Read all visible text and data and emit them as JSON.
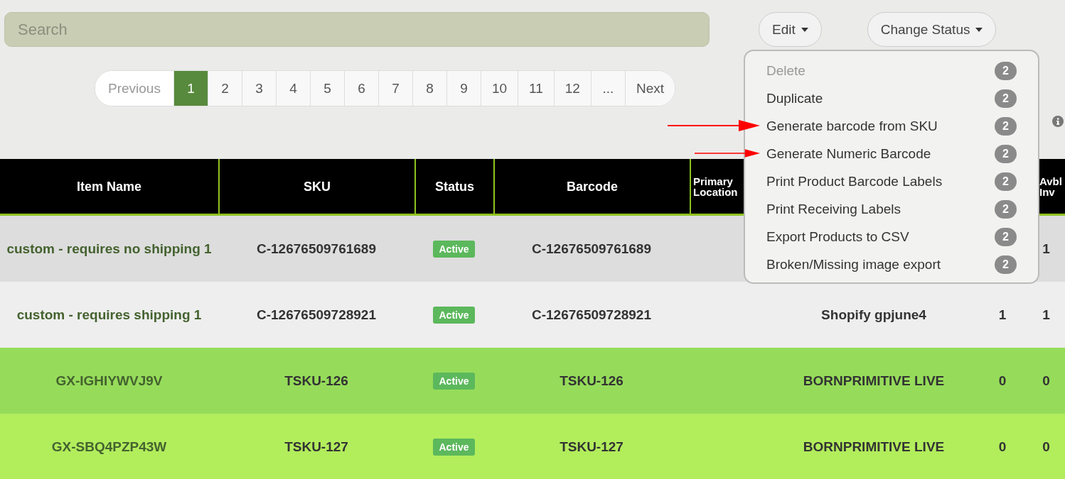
{
  "search": {
    "placeholder": "Search"
  },
  "toolbar": [
    {
      "label": "Edit",
      "kind": "dropdown"
    },
    {
      "label": "Change Status",
      "kind": "dropdown"
    }
  ],
  "pagination": [
    {
      "label": "Previous",
      "selected": false,
      "disabled": true
    },
    {
      "label": "1",
      "selected": true,
      "disabled": false
    },
    {
      "label": "2",
      "selected": false,
      "disabled": false
    },
    {
      "label": "3",
      "selected": false,
      "disabled": false
    },
    {
      "label": "4",
      "selected": false,
      "disabled": false
    },
    {
      "label": "5",
      "selected": false,
      "disabled": false
    },
    {
      "label": "6",
      "selected": false,
      "disabled": false
    },
    {
      "label": "7",
      "selected": false,
      "disabled": false
    },
    {
      "label": "8",
      "selected": false,
      "disabled": false
    },
    {
      "label": "9",
      "selected": false,
      "disabled": false
    },
    {
      "label": "10",
      "selected": false,
      "disabled": false
    },
    {
      "label": "11",
      "selected": false,
      "disabled": false
    },
    {
      "label": "12",
      "selected": false,
      "disabled": false
    },
    {
      "label": "...",
      "selected": false,
      "disabled": false
    },
    {
      "label": "Next",
      "selected": false,
      "disabled": false
    }
  ],
  "edit_menu": [
    {
      "label": "Delete",
      "badge": "2",
      "disabled": true,
      "arrow": false
    },
    {
      "label": "Duplicate",
      "badge": "2",
      "disabled": false,
      "arrow": false
    },
    {
      "label": "Generate barcode from SKU",
      "badge": "2",
      "disabled": false,
      "arrow": true
    },
    {
      "label": "Generate Numeric Barcode",
      "badge": "2",
      "disabled": false,
      "arrow": true
    },
    {
      "label": "Print Product Barcode Labels",
      "badge": "2",
      "disabled": false,
      "arrow": false
    },
    {
      "label": "Print Receiving Labels",
      "badge": "2",
      "disabled": false,
      "arrow": false
    },
    {
      "label": "Export Products to CSV",
      "badge": "2",
      "disabled": false,
      "arrow": false
    },
    {
      "label": "Broken/Missing image export",
      "badge": "2",
      "disabled": false,
      "arrow": false
    }
  ],
  "table": {
    "columns": [
      "Item Name",
      "SKU",
      "Status",
      "Barcode",
      "Primary Location",
      "Avbl Inv"
    ],
    "rows": [
      {
        "color": "#dddddd",
        "item_name": "custom - requires no shipping 1",
        "sku": "C-12676509761689",
        "status": "Active",
        "barcode": "C-12676509761689",
        "avbl_inv": "1"
      },
      {
        "color": "#eeeeee",
        "item_name": "custom - requires shipping 1",
        "sku": "C-12676509728921",
        "status": "Active",
        "barcode": "C-12676509728921",
        "store": "Shopify gpjune4",
        "qoh": "1",
        "avbl_inv": "1"
      },
      {
        "color": "#96dc5a",
        "item_name": "GX-IGHIYWVJ9V",
        "sku": "TSKU-126",
        "status": "Active",
        "barcode": "TSKU-126",
        "store": "BORNPRIMITIVE LIVE",
        "qoh": "0",
        "avbl_inv": "0"
      },
      {
        "color": "#b2ed5c",
        "item_name": "GX-SBQ4PZP43W",
        "sku": "TSKU-127",
        "status": "Active",
        "barcode": "TSKU-127",
        "store": "BORNPRIMITIVE LIVE",
        "qoh": "0",
        "avbl_inv": "0"
      }
    ]
  }
}
